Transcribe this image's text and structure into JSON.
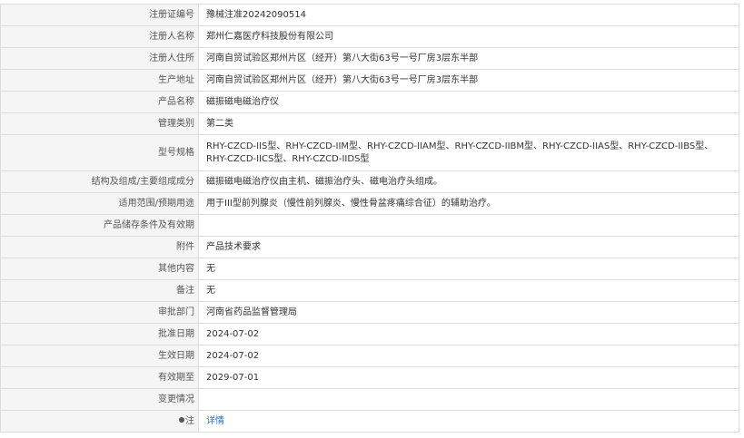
{
  "rows": [
    {
      "label": "注册证编号",
      "value": "豫械注准20242090514"
    },
    {
      "label": "注册人名称",
      "value": "郑州仁嘉医疗科技股份有限公司"
    },
    {
      "label": "注册人住所",
      "value": "河南自贸试验区郑州片区（经开）第八大街63号一号厂房3层东半部"
    },
    {
      "label": "生产地址",
      "value": "河南自贸试验区郑州片区（经开）第八大街63号一号厂房3层东半部"
    },
    {
      "label": "产品名称",
      "value": "磁振磁电磁治疗仪"
    },
    {
      "label": "管理类别",
      "value": "第二类"
    },
    {
      "label": "型号规格",
      "value": "RHY-CZCD-IIS型、RHY-CZCD-IIM型、RHY-CZCD-IIAM型、RHY-CZCD-IIBM型、RHY-CZCD-IIAS型、RHY-CZCD-IIBS型、RHY-CZCD-IICS型、RHY-CZCD-IIDS型"
    },
    {
      "label": "结构及组成/主要组成成分",
      "value": "磁振磁电磁治疗仪由主机、磁振治疗头、磁电治疗头组成。"
    },
    {
      "label": "适用范围/预期用途",
      "value": "用于III型前列腺炎（慢性前列腺炎、慢性骨盆疼痛综合征）的辅助治疗。"
    },
    {
      "label": "产品储存条件及有效期",
      "value": ""
    },
    {
      "label": "附件",
      "value": "产品技术要求"
    },
    {
      "label": "其他内容",
      "value": "无"
    },
    {
      "label": "备注",
      "value": "无"
    },
    {
      "label": "审批部门",
      "value": "河南省药品监督管理局"
    },
    {
      "label": "批准日期",
      "value": "2024-07-02"
    },
    {
      "label": "生效日期",
      "value": "2024-07-02"
    },
    {
      "label": "有效期至",
      "value": "2029-07-01"
    },
    {
      "label": "变更情况",
      "value": ""
    },
    {
      "label": "注",
      "value": "详情"
    }
  ]
}
